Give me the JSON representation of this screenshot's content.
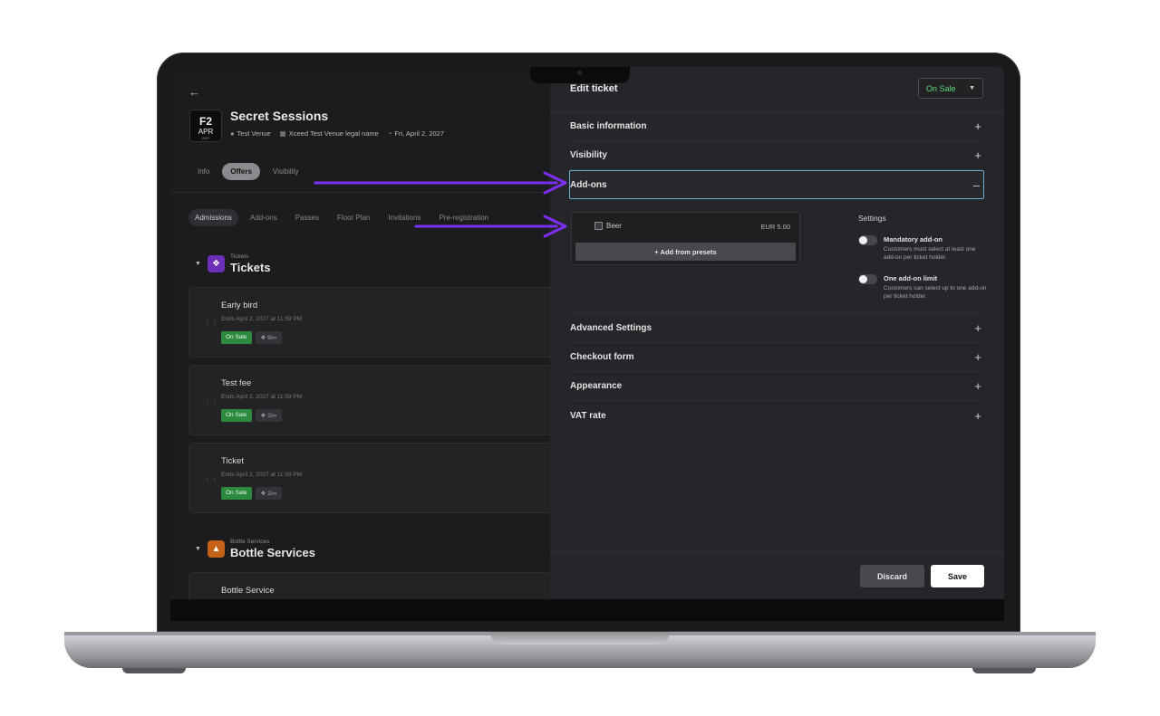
{
  "event": {
    "thumb_day": "F2",
    "thumb_month": "APR",
    "thumb_year": "2027",
    "title": "Secret Sessions",
    "venue": "Test Venue",
    "legal_name": "Xceed Test Venue legal name",
    "date": "Fri, April 2, 2027"
  },
  "top_tabs": [
    "Info",
    "Offers",
    "Visibility"
  ],
  "sub_tabs": [
    "Admissions",
    "Add-ons",
    "Passes",
    "Floor Plan",
    "Invitations",
    "Pre-registration"
  ],
  "sections": {
    "tickets": {
      "small": "Tickets",
      "big": "Tickets"
    },
    "bottle": {
      "small": "Bottle Services",
      "big": "Bottle Services"
    }
  },
  "cards": [
    {
      "name": "Early bird",
      "ends": "Ends April 2, 2027 at 11:59 PM",
      "status": "On Sale",
      "cap": "9/∞"
    },
    {
      "name": "Test fee",
      "ends": "Ends April 2, 2027 at 11:59 PM",
      "status": "On Sale",
      "cap": "2/∞"
    },
    {
      "name": "Ticket",
      "ends": "Ends April 2, 2027 at 11:59 PM",
      "status": "On Sale",
      "cap": "2/∞"
    }
  ],
  "bottle_card": {
    "name": "Bottle Service"
  },
  "panel": {
    "title": "Edit ticket",
    "status": "On Sale",
    "sections": {
      "basic": "Basic information",
      "visibility": "Visibility",
      "addons": "Add-ons",
      "advanced": "Advanced Settings",
      "checkout": "Checkout form",
      "appearance": "Appearance",
      "vat": "VAT rate"
    },
    "addon_item": {
      "name": "Beer",
      "price": "EUR 5.00"
    },
    "add_presets": "+ Add from presets",
    "settings": {
      "title": "Settings",
      "mandatory_label": "Mandatory add-on",
      "mandatory_desc": "Customers must select at least one add-on per ticket holder.",
      "limit_label": "One add-on limit",
      "limit_desc": "Customers can select up to one add-on per ticket holder."
    },
    "discard": "Discard",
    "save": "Save"
  },
  "colors": {
    "arrow": "#7b2ff2",
    "on_sale": "#2c8a3e",
    "status_text": "#5ddc7a"
  }
}
